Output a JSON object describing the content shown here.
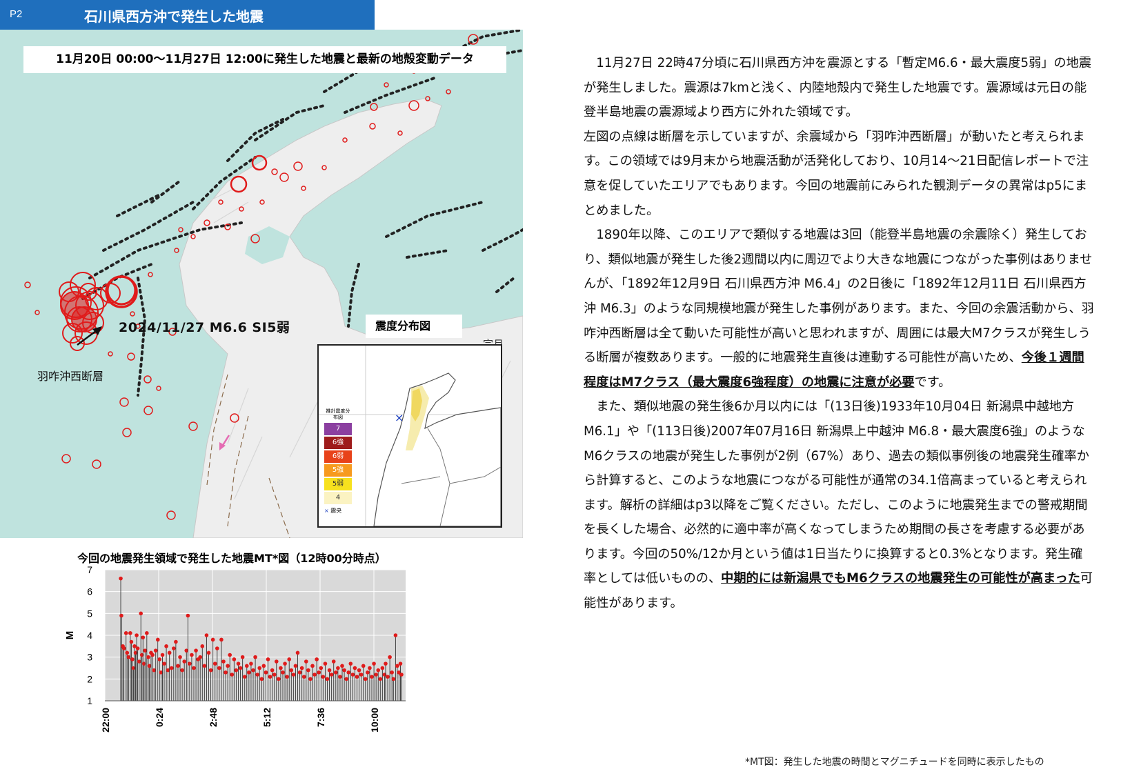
{
  "header": {
    "page": "P2",
    "title": "石川県西方沖で発生した地震"
  },
  "map": {
    "subtitle": "11月20日 00:00～11月27日 12:00に発生した地震と最新の地殻変動データ",
    "event_label": "2024/11/27 M6.6 SI5弱",
    "fault_label": "羽咋沖西断層",
    "inset_title": "震度分布図",
    "inset_cut_label": "宗月",
    "legend": {
      "title": "推計震度分布図",
      "items": [
        {
          "label": "7",
          "color": "#8b3fa0"
        },
        {
          "label": "6強",
          "color": "#9e1b1b"
        },
        {
          "label": "6弱",
          "color": "#e8421a"
        },
        {
          "label": "5強",
          "color": "#f79a1e"
        },
        {
          "label": "5弱",
          "color": "#f7e11e"
        },
        {
          "label": "4",
          "color": "#fbf3c2"
        }
      ],
      "epicenter_label": "震央"
    },
    "colors": {
      "sea": "#bfe3de",
      "land": "#eeeeee",
      "quake": "#e01b1b",
      "fault": "#222222"
    }
  },
  "chart_title": "今回の地震発生領域で発生した地震MT*図（12時00分時点）",
  "chart_data": {
    "type": "scatter",
    "title": "今回の地震発生領域で発生した地震MT*図（12時00分時点）",
    "xlabel": "",
    "ylabel": "M",
    "ylim": [
      1,
      7
    ],
    "yticks": [
      "1",
      "2",
      "3",
      "4",
      "5",
      "6",
      "7"
    ],
    "xticks": [
      "22:00",
      "0:24",
      "2:48",
      "5:12",
      "7:36",
      "10:00"
    ],
    "x_range_hours": [
      22.0,
      36.0
    ],
    "points": [
      [
        22.75,
        6.6
      ],
      [
        22.78,
        4.9
      ],
      [
        22.85,
        3.5
      ],
      [
        22.9,
        3.4
      ],
      [
        23.0,
        4.1
      ],
      [
        23.05,
        3.2
      ],
      [
        23.12,
        3.0
      ],
      [
        23.2,
        4.1
      ],
      [
        23.25,
        3.7
      ],
      [
        23.3,
        2.9
      ],
      [
        23.35,
        2.5
      ],
      [
        23.4,
        3.5
      ],
      [
        23.45,
        3.2
      ],
      [
        23.5,
        4.0
      ],
      [
        23.55,
        3.4
      ],
      [
        23.62,
        2.8
      ],
      [
        23.7,
        5.0
      ],
      [
        23.75,
        3.1
      ],
      [
        23.8,
        3.9
      ],
      [
        23.85,
        2.7
      ],
      [
        23.9,
        3.3
      ],
      [
        23.98,
        4.1
      ],
      [
        24.05,
        3.0
      ],
      [
        24.1,
        2.6
      ],
      [
        24.18,
        3.2
      ],
      [
        24.25,
        3.1
      ],
      [
        24.32,
        2.4
      ],
      [
        24.4,
        3.3
      ],
      [
        24.5,
        3.8
      ],
      [
        24.58,
        2.9
      ],
      [
        24.65,
        2.3
      ],
      [
        24.72,
        3.1
      ],
      [
        24.8,
        2.7
      ],
      [
        24.9,
        3.5
      ],
      [
        24.98,
        2.4
      ],
      [
        25.05,
        3.2
      ],
      [
        25.15,
        2.5
      ],
      [
        25.25,
        3.4
      ],
      [
        25.35,
        3.7
      ],
      [
        25.45,
        2.6
      ],
      [
        25.55,
        3.0
      ],
      [
        25.65,
        2.4
      ],
      [
        25.75,
        2.8
      ],
      [
        25.85,
        3.3
      ],
      [
        25.92,
        4.9
      ],
      [
        26.0,
        2.7
      ],
      [
        26.1,
        3.1
      ],
      [
        26.2,
        2.5
      ],
      [
        26.3,
        3.3
      ],
      [
        26.4,
        2.9
      ],
      [
        26.5,
        3.0
      ],
      [
        26.6,
        3.5
      ],
      [
        26.7,
        2.6
      ],
      [
        26.8,
        4.0
      ],
      [
        26.9,
        3.2
      ],
      [
        27.0,
        2.4
      ],
      [
        27.1,
        3.8
      ],
      [
        27.2,
        2.7
      ],
      [
        27.3,
        3.4
      ],
      [
        27.4,
        2.5
      ],
      [
        27.5,
        3.8
      ],
      [
        27.6,
        2.8
      ],
      [
        27.7,
        2.3
      ],
      [
        27.8,
        2.6
      ],
      [
        27.9,
        3.1
      ],
      [
        28.0,
        2.2
      ],
      [
        28.1,
        2.9
      ],
      [
        28.2,
        2.4
      ],
      [
        28.3,
        2.7
      ],
      [
        28.4,
        2.5
      ],
      [
        28.5,
        3.0
      ],
      [
        28.6,
        2.1
      ],
      [
        28.7,
        2.6
      ],
      [
        28.8,
        2.3
      ],
      [
        28.9,
        2.7
      ],
      [
        29.0,
        2.4
      ],
      [
        29.1,
        3.0
      ],
      [
        29.2,
        2.2
      ],
      [
        29.3,
        2.5
      ],
      [
        29.4,
        2.0
      ],
      [
        29.5,
        2.6
      ],
      [
        29.6,
        2.3
      ],
      [
        29.7,
        2.9
      ],
      [
        29.8,
        2.1
      ],
      [
        29.9,
        2.4
      ],
      [
        30.0,
        2.2
      ],
      [
        30.1,
        2.8
      ],
      [
        30.2,
        2.0
      ],
      [
        30.3,
        2.5
      ],
      [
        30.4,
        2.3
      ],
      [
        30.5,
        2.7
      ],
      [
        30.6,
        2.1
      ],
      [
        30.7,
        2.9
      ],
      [
        30.8,
        2.4
      ],
      [
        30.9,
        2.2
      ],
      [
        31.0,
        2.6
      ],
      [
        31.1,
        3.2
      ],
      [
        31.2,
        2.3
      ],
      [
        31.3,
        2.5
      ],
      [
        31.4,
        2.1
      ],
      [
        31.5,
        2.8
      ],
      [
        31.6,
        2.4
      ],
      [
        31.7,
        2.0
      ],
      [
        31.8,
        2.6
      ],
      [
        31.9,
        2.2
      ],
      [
        32.0,
        2.9
      ],
      [
        32.1,
        2.3
      ],
      [
        32.2,
        2.5
      ],
      [
        32.3,
        2.1
      ],
      [
        32.4,
        2.7
      ],
      [
        32.5,
        2.0
      ],
      [
        32.6,
        2.4
      ],
      [
        32.7,
        2.2
      ],
      [
        32.8,
        2.8
      ],
      [
        32.9,
        2.3
      ],
      [
        33.0,
        2.5
      ],
      [
        33.1,
        2.1
      ],
      [
        33.2,
        2.6
      ],
      [
        33.3,
        2.4
      ],
      [
        33.4,
        2.0
      ],
      [
        33.5,
        2.3
      ],
      [
        33.6,
        2.7
      ],
      [
        33.7,
        2.2
      ],
      [
        33.8,
        2.5
      ],
      [
        33.9,
        2.1
      ],
      [
        34.0,
        2.4
      ],
      [
        34.1,
        2.2
      ],
      [
        34.2,
        2.6
      ],
      [
        34.3,
        2.0
      ],
      [
        34.4,
        2.3
      ],
      [
        34.5,
        2.5
      ],
      [
        34.6,
        2.1
      ],
      [
        34.7,
        2.7
      ],
      [
        34.8,
        2.2
      ],
      [
        34.9,
        2.4
      ],
      [
        35.0,
        2.0
      ],
      [
        35.1,
        2.5
      ],
      [
        35.2,
        2.2
      ],
      [
        35.25,
        2.7
      ],
      [
        35.35,
        2.1
      ],
      [
        35.45,
        3.0
      ],
      [
        35.55,
        2.3
      ],
      [
        35.62,
        2.0
      ],
      [
        35.72,
        4.0
      ],
      [
        35.8,
        2.6
      ],
      [
        35.88,
        2.3
      ],
      [
        35.95,
        2.7
      ],
      [
        36.0,
        2.2
      ]
    ]
  },
  "text": {
    "p1": "11月27日 22時47分頃に石川県西方沖を震源とする「暫定M6.6・最大震度5弱」の地震が発生しました。震源は7kmと浅く、内陸地殻内で発生した地震です。震源域は元日の能登半島地震の震源域より西方に外れた領域です。",
    "p2": "左図の点線は断層を示していますが、余震域から「羽咋沖西断層」が動いたと考えられます。この領域では9月末から地震活動が活発化しており、10月14～21日配信レポートで注意を促していたエリアでもあります。今回の地震前にみられた観測データの異常はp5にまとめました。",
    "p3a": "1890年以降、このエリアで類似する地震は3回（能登半島地震の余震除く）発生しており、類似地震が発生した後2週間以内に周辺でより大きな地震につながった事例はありませんが、「1892年12月9日 石川県西方沖 M6.4」の2日後に「1892年12月11日 石川県西方沖 M6.3」のような同規模地震が発生した事例があります。また、今回の余震活動から、羽咋沖西断層は全て動いた可能性が高いと思われますが、周囲には最大M7クラスが発生しうる断層が複数あります。一般的に地震発生直後は連動する可能性が高いため、",
    "p3b": "今後１週間程度はM7クラス（最大震度6強程度）の地震に注意が必要",
    "p3c": "です。",
    "p4a": "また、類似地震の発生後6か月以内には「(13日後)1933年10月04日 新潟県中越地方 M6.1」や「(113日後)2007年07月16日 新潟県上中越沖 M6.8・最大震度6強」のようなM6クラスの地震が発生した事例が2例（67%）あり、過去の類似事例後の地震発生確率から計算すると、このような地震につながる可能性が通常の34.1倍高まっていると考えられます。解析の詳細はp3以降をご覧ください。ただし、このように地震発生までの警戒期間を長くした場合、必然的に適中率が高くなってしまうため期間の長さを考慮する必要があります。今回の50%/12か月という値は1日当たりに換算すると0.3%となります。発生確率としては低いものの、",
    "p4b": "中期的には新潟県でもM6クラスの地震発生の可能性が高まった",
    "p4c": "可能性があります。"
  },
  "footnote": "*MT図：発生した地震の時間とマグニチュードを同時に表示したもの"
}
